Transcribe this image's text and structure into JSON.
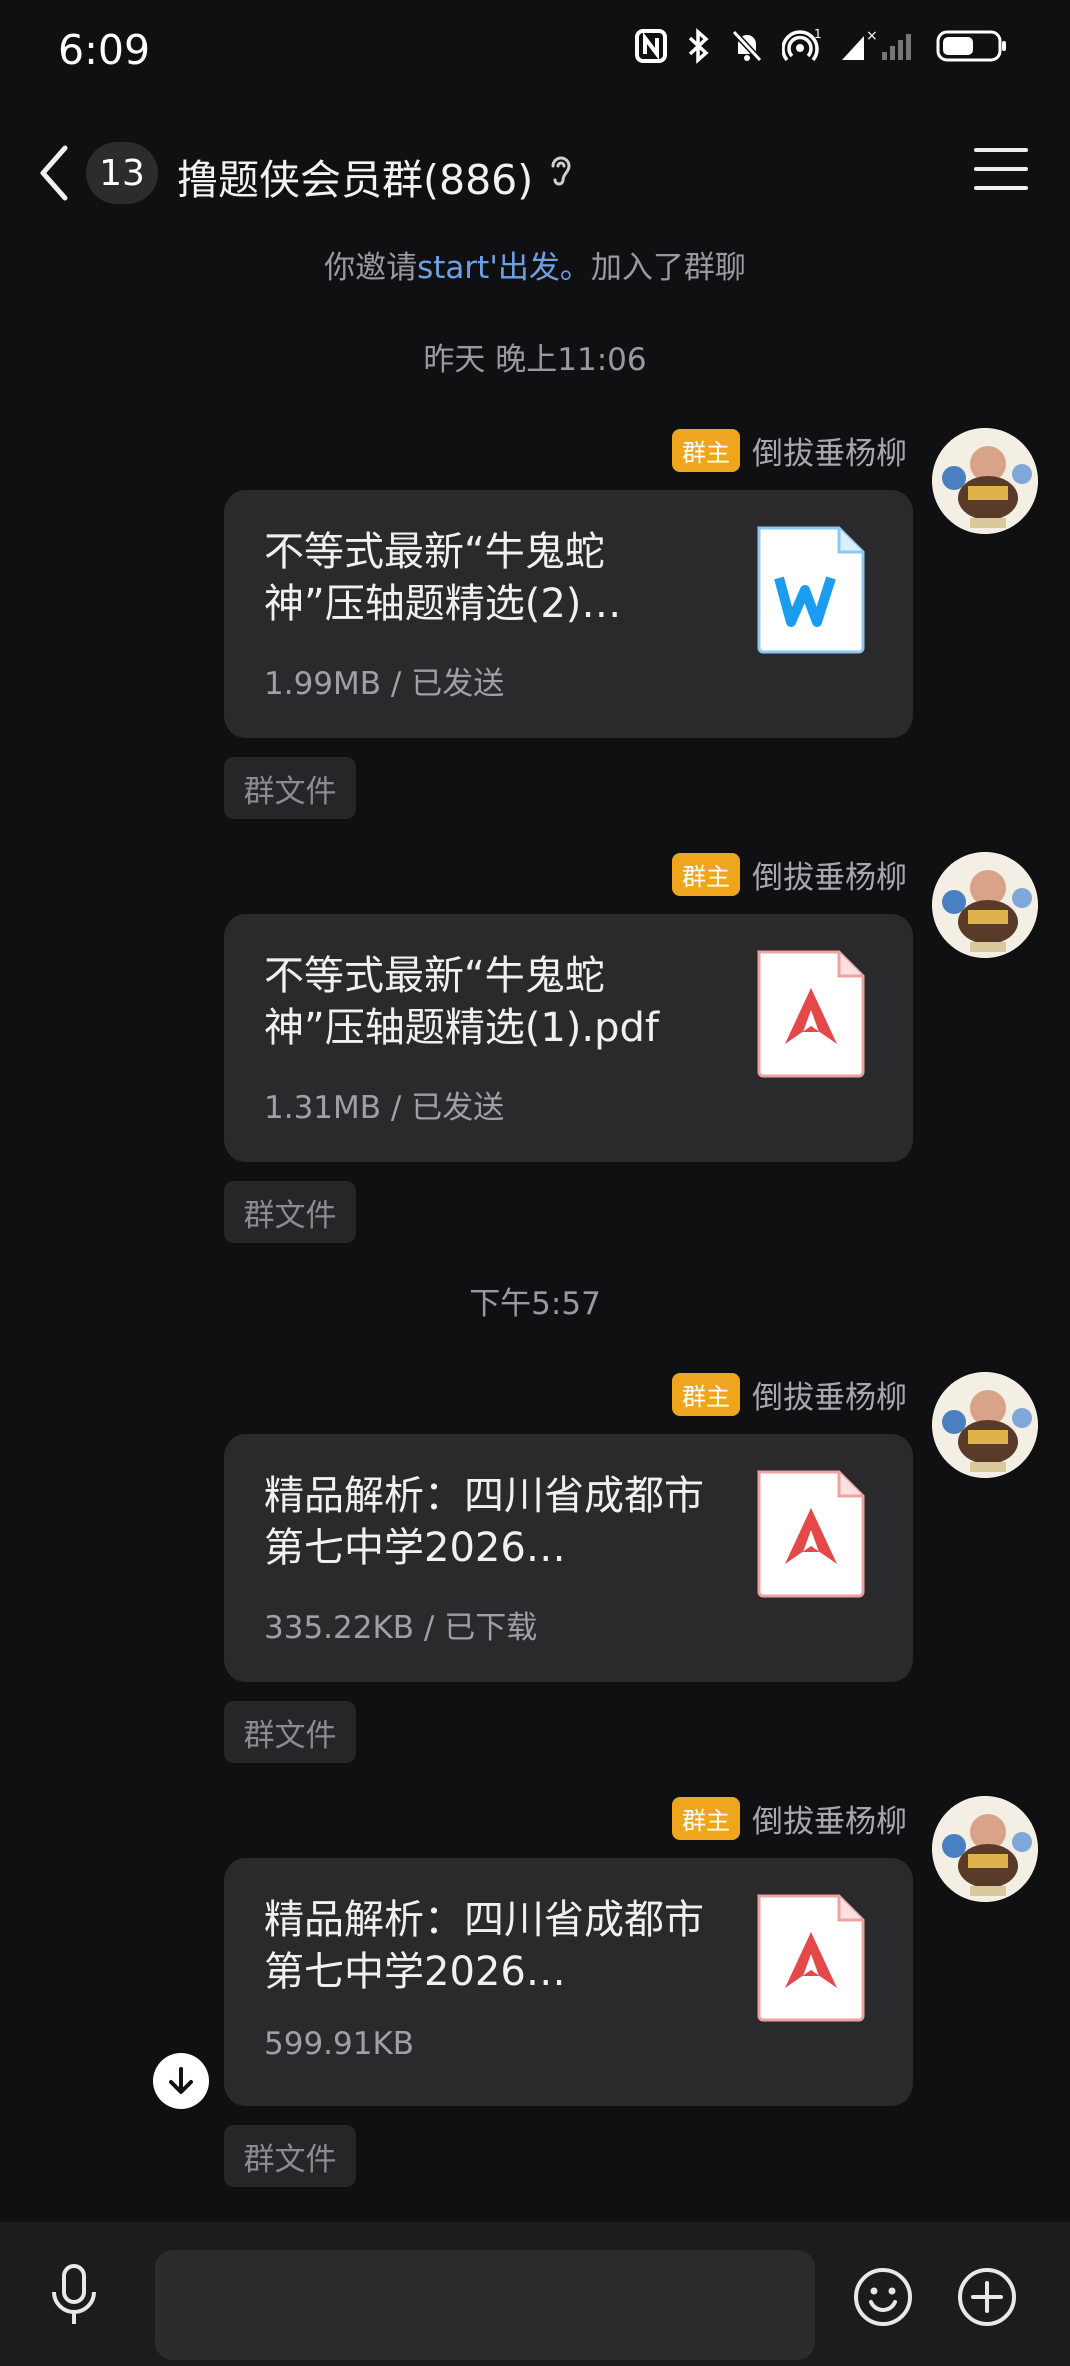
{
  "status_bar": {
    "time": "6:09"
  },
  "header": {
    "unread_count": "13",
    "title": "撸题侠会员群(886)"
  },
  "system_notice": {
    "prefix": "你邀请",
    "link_name": "start'出发。",
    "suffix": "加入了群聊"
  },
  "timestamps": [
    "昨天 晚上11:06",
    "下午5:57"
  ],
  "sender": {
    "badge": "群主",
    "name": "倒拔垂杨柳"
  },
  "messages": [
    {
      "file_name": "不等式最新“牛鬼蛇神”压轴题精选(2)…",
      "meta": "1.99MB / 已发送",
      "file_type": "word-icon",
      "tag": "群文件"
    },
    {
      "file_name": "不等式最新“牛鬼蛇神”压轴题精选(1).pdf",
      "meta": "1.31MB / 已发送",
      "file_type": "pdf-icon",
      "tag": "群文件"
    },
    {
      "file_name": "精品解析：四川省成都市第七中学2026…",
      "meta": "335.22KB / 已下载",
      "file_type": "pdf-icon",
      "tag": "群文件"
    },
    {
      "file_name": "精品解析：四川省成都市第七中学2026…",
      "meta": "599.91KB",
      "file_type": "pdf-icon",
      "tag": "群文件"
    }
  ],
  "input": {
    "placeholder": ""
  },
  "colors": {
    "background": "#101012",
    "bubble": "#2a2a2c",
    "owner_badge": "#f0a51e",
    "link": "#6fa0e6",
    "pdf_red": "#e54848",
    "word_blue": "#1a9df0"
  }
}
